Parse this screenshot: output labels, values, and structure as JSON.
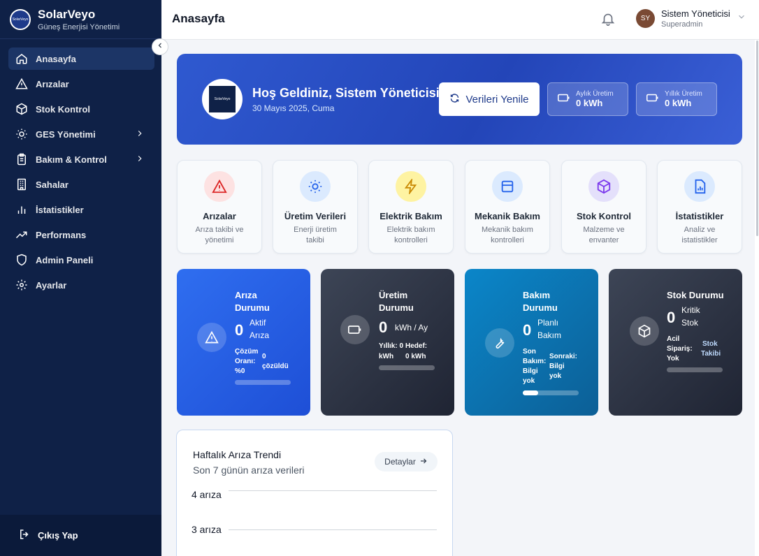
{
  "sidebar": {
    "brand_name": "SolarVeyo",
    "brand_subtitle": "Güneş Enerjisi Yönetimi",
    "logo_text": "SolarVeyo",
    "items": [
      {
        "label": "Anasayfa",
        "icon": "home-icon"
      },
      {
        "label": "Arızalar",
        "icon": "warning-icon"
      },
      {
        "label": "Stok Kontrol",
        "icon": "box-icon"
      },
      {
        "label": "GES Yönetimi",
        "icon": "sun-icon"
      },
      {
        "label": "Bakım & Kontrol",
        "icon": "clipboard-icon"
      },
      {
        "label": "Sahalar",
        "icon": "building-icon"
      },
      {
        "label": "İstatistikler",
        "icon": "bar-chart-icon"
      },
      {
        "label": "Performans",
        "icon": "trending-up-icon"
      },
      {
        "label": "Admin Paneli",
        "icon": "shield-icon"
      },
      {
        "label": "Ayarlar",
        "icon": "gear-icon"
      }
    ],
    "logout_label": "Çıkış Yap"
  },
  "header": {
    "title": "Anasayfa",
    "user_initials": "SY",
    "user_name": "Sistem Yöneticisi",
    "user_role": "Superadmin"
  },
  "hero": {
    "logo_text": "SolarVeyo",
    "welcome": "Hoş Geldiniz, Sistem Yöneticisi",
    "date": "30 Mayıs 2025, Cuma",
    "refresh_label": "Verileri Yenile",
    "monthly_label": "Aylık Üretim",
    "monthly_value": "0 kWh",
    "yearly_label": "Yıllık Üretim",
    "yearly_value": "0 kWh"
  },
  "quick_actions": [
    {
      "title": "Arızalar",
      "subtitle": "Arıza takibi ve yönetimi",
      "icon": "warning-icon",
      "color": "#dc2626",
      "bg": "#fde2e2"
    },
    {
      "title": "Üretim Verileri",
      "subtitle": "Enerji üretim takibi",
      "icon": "sun-icon",
      "color": "#2563eb",
      "bg": "#dbeafe"
    },
    {
      "title": "Elektrik Bakım",
      "subtitle": "Elektrik bakım kontrolleri",
      "icon": "lightning-icon",
      "color": "#ca8a04",
      "bg": "#fef3a2"
    },
    {
      "title": "Mekanik Bakım",
      "subtitle": "Mekanik bakım kontrolleri",
      "icon": "panel-icon",
      "color": "#2563eb",
      "bg": "#dbeafe"
    },
    {
      "title": "Stok Kontrol",
      "subtitle": "Malzeme ve envanter",
      "icon": "box-icon",
      "color": "#7c3aed",
      "bg": "#e4e0fb"
    },
    {
      "title": "İstatistikler",
      "subtitle": "Analiz ve istatistikler",
      "icon": "report-icon",
      "color": "#2563eb",
      "bg": "#dbeafe"
    }
  ],
  "stats": {
    "ariza": {
      "title_1": "Arıza",
      "title_2": "Durumu",
      "value": "0",
      "unit_1": "Aktif",
      "unit_2": "Arıza",
      "l1": "Çözüm",
      "l2": "Oranı:",
      "l3": "%0",
      "r1": "0",
      "r2": "çözüldü",
      "progress": 0
    },
    "uretim": {
      "title_1": "Üretim",
      "title_2": "Durumu",
      "value": "0",
      "unit": "kWh / Ay",
      "l1": "Yıllık: 0",
      "l2": "kWh",
      "r1": "Hedef:",
      "r2": "0 kWh",
      "progress": 0
    },
    "bakim": {
      "title_1": "Bakım",
      "title_2": "Durumu",
      "value": "0",
      "unit_1": "Planlı",
      "unit_2": "Bakım",
      "l1": "Son",
      "l2": "Bakım:",
      "l3": "Bilgi",
      "l4": "yok",
      "r1": "Sonraki:",
      "r2": "Bilgi",
      "r3": "yok",
      "progress": 0.28
    },
    "stok": {
      "title": "Stok Durumu",
      "value": "0",
      "unit_1": "Kritik",
      "unit_2": "Stok",
      "l1": "Acil",
      "l2": "Sipariş:",
      "l3": "Yok",
      "r1": "Stok",
      "r2": "Takibi",
      "progress": 0
    }
  },
  "trend": {
    "title": "Haftalık Arıza Trendi",
    "subtitle": "Son 7 günün arıza verileri",
    "details_label": "Detaylar",
    "y_labels": [
      "4 arıza",
      "3 arıza"
    ]
  }
}
